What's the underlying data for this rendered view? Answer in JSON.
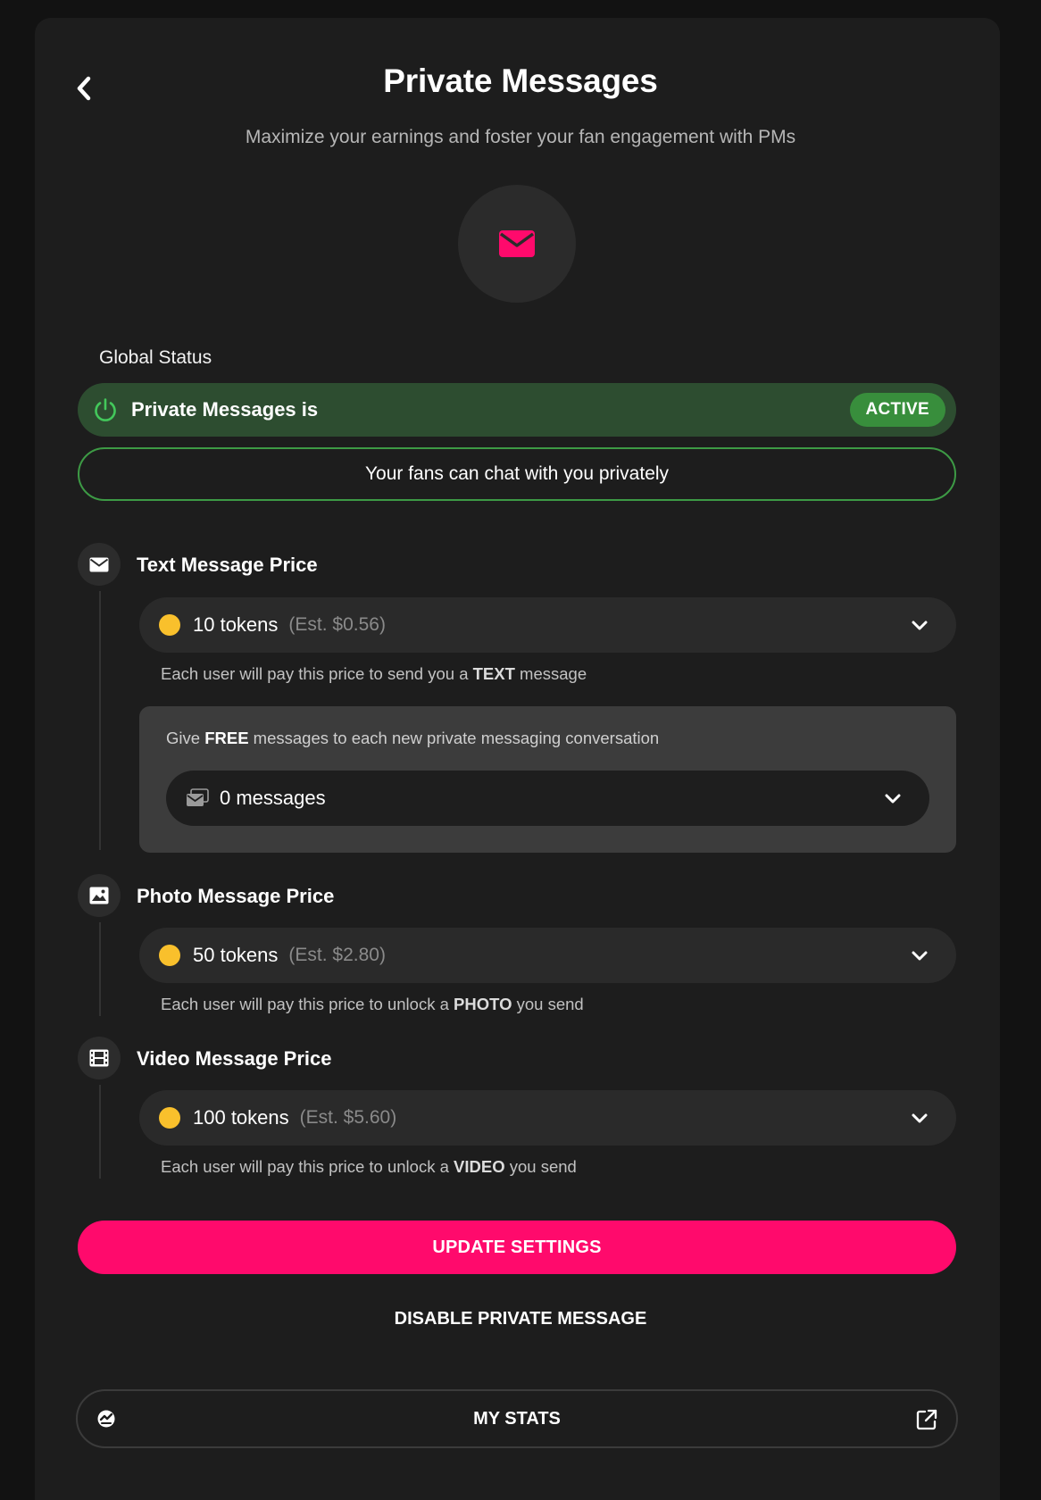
{
  "header": {
    "title": "Private Messages",
    "subtitle": "Maximize your earnings and foster your fan engagement with PMs"
  },
  "global_status": {
    "section_label": "Global Status",
    "label": "Private Messages is",
    "badge": "ACTIVE",
    "note": "Your fans can chat with you privately"
  },
  "text_price": {
    "title": "Text Message Price",
    "amount": "10 tokens",
    "estimate": "(Est. $0.56)",
    "helper_prefix": "Each user will pay this price to send you a",
    "helper_bold": "TEXT",
    "helper_suffix": "message"
  },
  "free_messages": {
    "prefix": "Give",
    "bold": "FREE",
    "suffix": "messages to each new private messaging conversation",
    "value": "0 messages"
  },
  "photo_price": {
    "title": "Photo Message Price",
    "amount": "50 tokens",
    "estimate": "(Est. $2.80)",
    "helper_prefix": "Each user will pay this price to unlock a",
    "helper_bold": "PHOTO",
    "helper_suffix": "you send"
  },
  "video_price": {
    "title": "Video Message Price",
    "amount": "100 tokens",
    "estimate": "(Est. $5.60)",
    "helper_prefix": "Each user will pay this price to unlock a",
    "helper_bold": "VIDEO",
    "helper_suffix": "you send"
  },
  "actions": {
    "update_label": "UPDATE SETTINGS",
    "disable_label": "DISABLE PRIVATE MESSAGE",
    "stats_label": "MY STATS"
  },
  "colors": {
    "accent": "#ff0a6c",
    "active_bg": "#2d4d30",
    "active_badge": "#388e3c",
    "coin": "#f9c02c"
  },
  "icons": {
    "back": "chevron-left-icon",
    "hero": "envelope-icon",
    "status": "power-icon",
    "text": "envelope-icon",
    "photo": "image-icon",
    "video": "film-icon",
    "coin": "coin-icon",
    "dropdown": "chevron-down-icon",
    "free_messages": "envelopes-icon",
    "stats_left": "stats-icon",
    "stats_right": "external-link-icon"
  }
}
